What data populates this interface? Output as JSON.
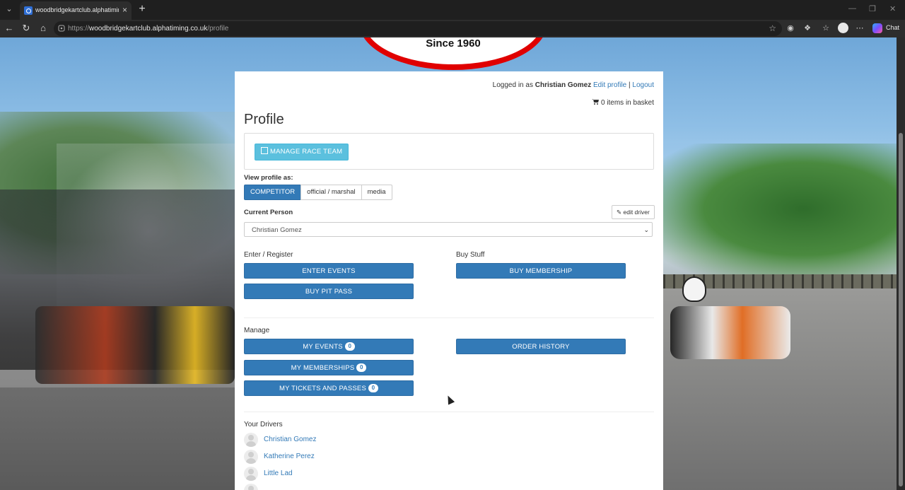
{
  "browser": {
    "tab_title": "woodbridgekartclub.alphatiming.co.uk",
    "url_prefix": "https://",
    "url_host": "woodbridgekartclub.alphatiming.co.uk",
    "url_path": "/profile",
    "chat_label": "Chat"
  },
  "logo": {
    "since": "Since 1960"
  },
  "header": {
    "logged_in_prefix": "Logged in as",
    "user_name": "Christian Gomez",
    "edit_profile": "Edit profile",
    "separator": "|",
    "logout": "Logout",
    "basket": "0 items in basket"
  },
  "page_title": "Profile",
  "race_team_button": "MANAGE RACE TEAM",
  "view_profile": {
    "label": "View profile as:",
    "options": [
      "COMPETITOR",
      "official / marshal",
      "media"
    ],
    "selected": "COMPETITOR"
  },
  "current_person": {
    "label": "Current Person",
    "edit_driver": "edit driver",
    "selected": "Christian Gomez"
  },
  "enter_register": {
    "label": "Enter / Register",
    "enter_events": "ENTER EVENTS",
    "buy_pit_pass": "BUY PIT PASS"
  },
  "buy_stuff": {
    "label": "Buy Stuff",
    "buy_membership": "BUY MEMBERSHIP"
  },
  "manage": {
    "label": "Manage",
    "my_events": "MY EVENTS",
    "my_events_count": "0",
    "my_memberships": "MY MEMBERSHIPS",
    "my_memberships_count": "0",
    "my_tickets": "MY TICKETS AND PASSES",
    "my_tickets_count": "0",
    "order_history": "ORDER HISTORY"
  },
  "drivers": {
    "label": "Your Drivers",
    "list": [
      "Christian Gomez",
      "Katherine Perez",
      "Little Lad"
    ]
  }
}
